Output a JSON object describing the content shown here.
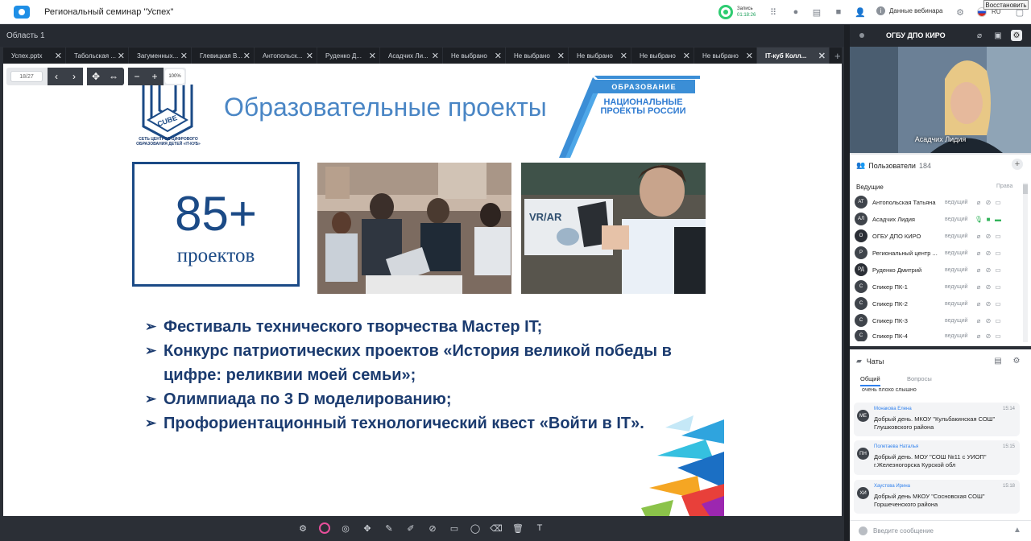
{
  "topbar": {
    "app_title": "Региональный семинар \"Успех\"",
    "rec_label": "Запись",
    "rec_time": "01:18:26",
    "webinar_data": "Данные вебинара",
    "lang": "RU",
    "tooltip": "Восстановить"
  },
  "area": {
    "title": "Область 1"
  },
  "tabs": [
    "Успех.pptx",
    "Табольская ...",
    "Загуменных...",
    "Глевицкая В...",
    "Антопольск...",
    "Руденко Д...",
    "Асадчих Ли...",
    "Не выбрано",
    "Не выбрано",
    "Не выбрано",
    "Не выбрано",
    "Не выбрано",
    "IT-куб Колл..."
  ],
  "viewer": {
    "page": "18/27",
    "zoom": "100%"
  },
  "slide": {
    "title": "Образовательные проекты",
    "cube_caption": "СЕТЬ ЦЕНТРОВ ЦИФРОВОГО ОБРАЗОВАНИЯ ДЕТЕЙ «IT-КУБ»",
    "cube_word": "CUBE",
    "np_band": "ОБРАЗОВАНИЕ",
    "np_text": "НАЦИОНАЛЬНЫЕ ПРОЕКТЫ РОССИИ",
    "counter_num": "85+",
    "counter_label": "проектов",
    "photo2_sign": "VR/AR",
    "bullets": [
      "Фестиваль технического творчества Мастер IT;",
      "Конкурс патриотических проектов «История великой победы в цифре: реликвии моей семьи»;",
      "Олимпиада по 3 D моделированию;",
      "Профориентационный технологический квест «Войти в IT»."
    ]
  },
  "right": {
    "org_name": "ОГБУ ДПО КИРО",
    "video_name": "Асадчих Лидия",
    "users_label": "Пользователи",
    "users_count": "184",
    "hosts_label": "Ведущие",
    "rights_label": "Права",
    "users": [
      {
        "initials": "АТ",
        "name": "Антопольская Татьяна",
        "role": "ведущий",
        "color": "#3f444b"
      },
      {
        "initials": "АЛ",
        "name": "Асадчих Лидия",
        "role": "ведущий",
        "color": "#3f444b"
      },
      {
        "initials": "О",
        "name": "ОГБУ ДПО КИРО",
        "role": "ведущий",
        "color": "#2b2f36"
      },
      {
        "initials": "Р",
        "name": "Региональный центр ...",
        "role": "ведущий",
        "color": "#3f444b"
      },
      {
        "initials": "РД",
        "name": "Руденко Дмитрий",
        "role": "ведущий",
        "color": "#2b2f36"
      },
      {
        "initials": "С",
        "name": "Спикер ПК-1",
        "role": "ведущий",
        "color": "#3f444b"
      },
      {
        "initials": "С",
        "name": "Спикер ПК-2",
        "role": "ведущий",
        "color": "#3f444b"
      },
      {
        "initials": "С",
        "name": "Спикер ПК-3",
        "role": "ведущий",
        "color": "#3f444b"
      },
      {
        "initials": "С",
        "name": "Спикер ПК-4",
        "role": "ведущий",
        "color": "#3f444b"
      }
    ],
    "chats_label": "Чаты",
    "chat_tab_general": "Общий",
    "chat_tab_questions": "Вопросы",
    "msg_fragment": "очень плохо слышно",
    "messages": [
      {
        "initials": "МЕ",
        "author": "Монакова Елена",
        "time": "15:14",
        "text": "Добрый день. МКОУ \"Кульбакинская СОШ\" Глушковского района"
      },
      {
        "initials": "ПН",
        "author": "Полетаева Наталья",
        "time": "15:15",
        "text": "Добрый день. МОУ \"СОШ №11 с УИОП\" г.Железногорска Курской обл"
      },
      {
        "initials": "ХИ",
        "author": "Хаустова Ирина",
        "time": "15:18",
        "text": "Добрый день МКОУ \"Сосновская СОШ\" Горшеченского района"
      }
    ],
    "input_placeholder": "Введите сообщение"
  }
}
